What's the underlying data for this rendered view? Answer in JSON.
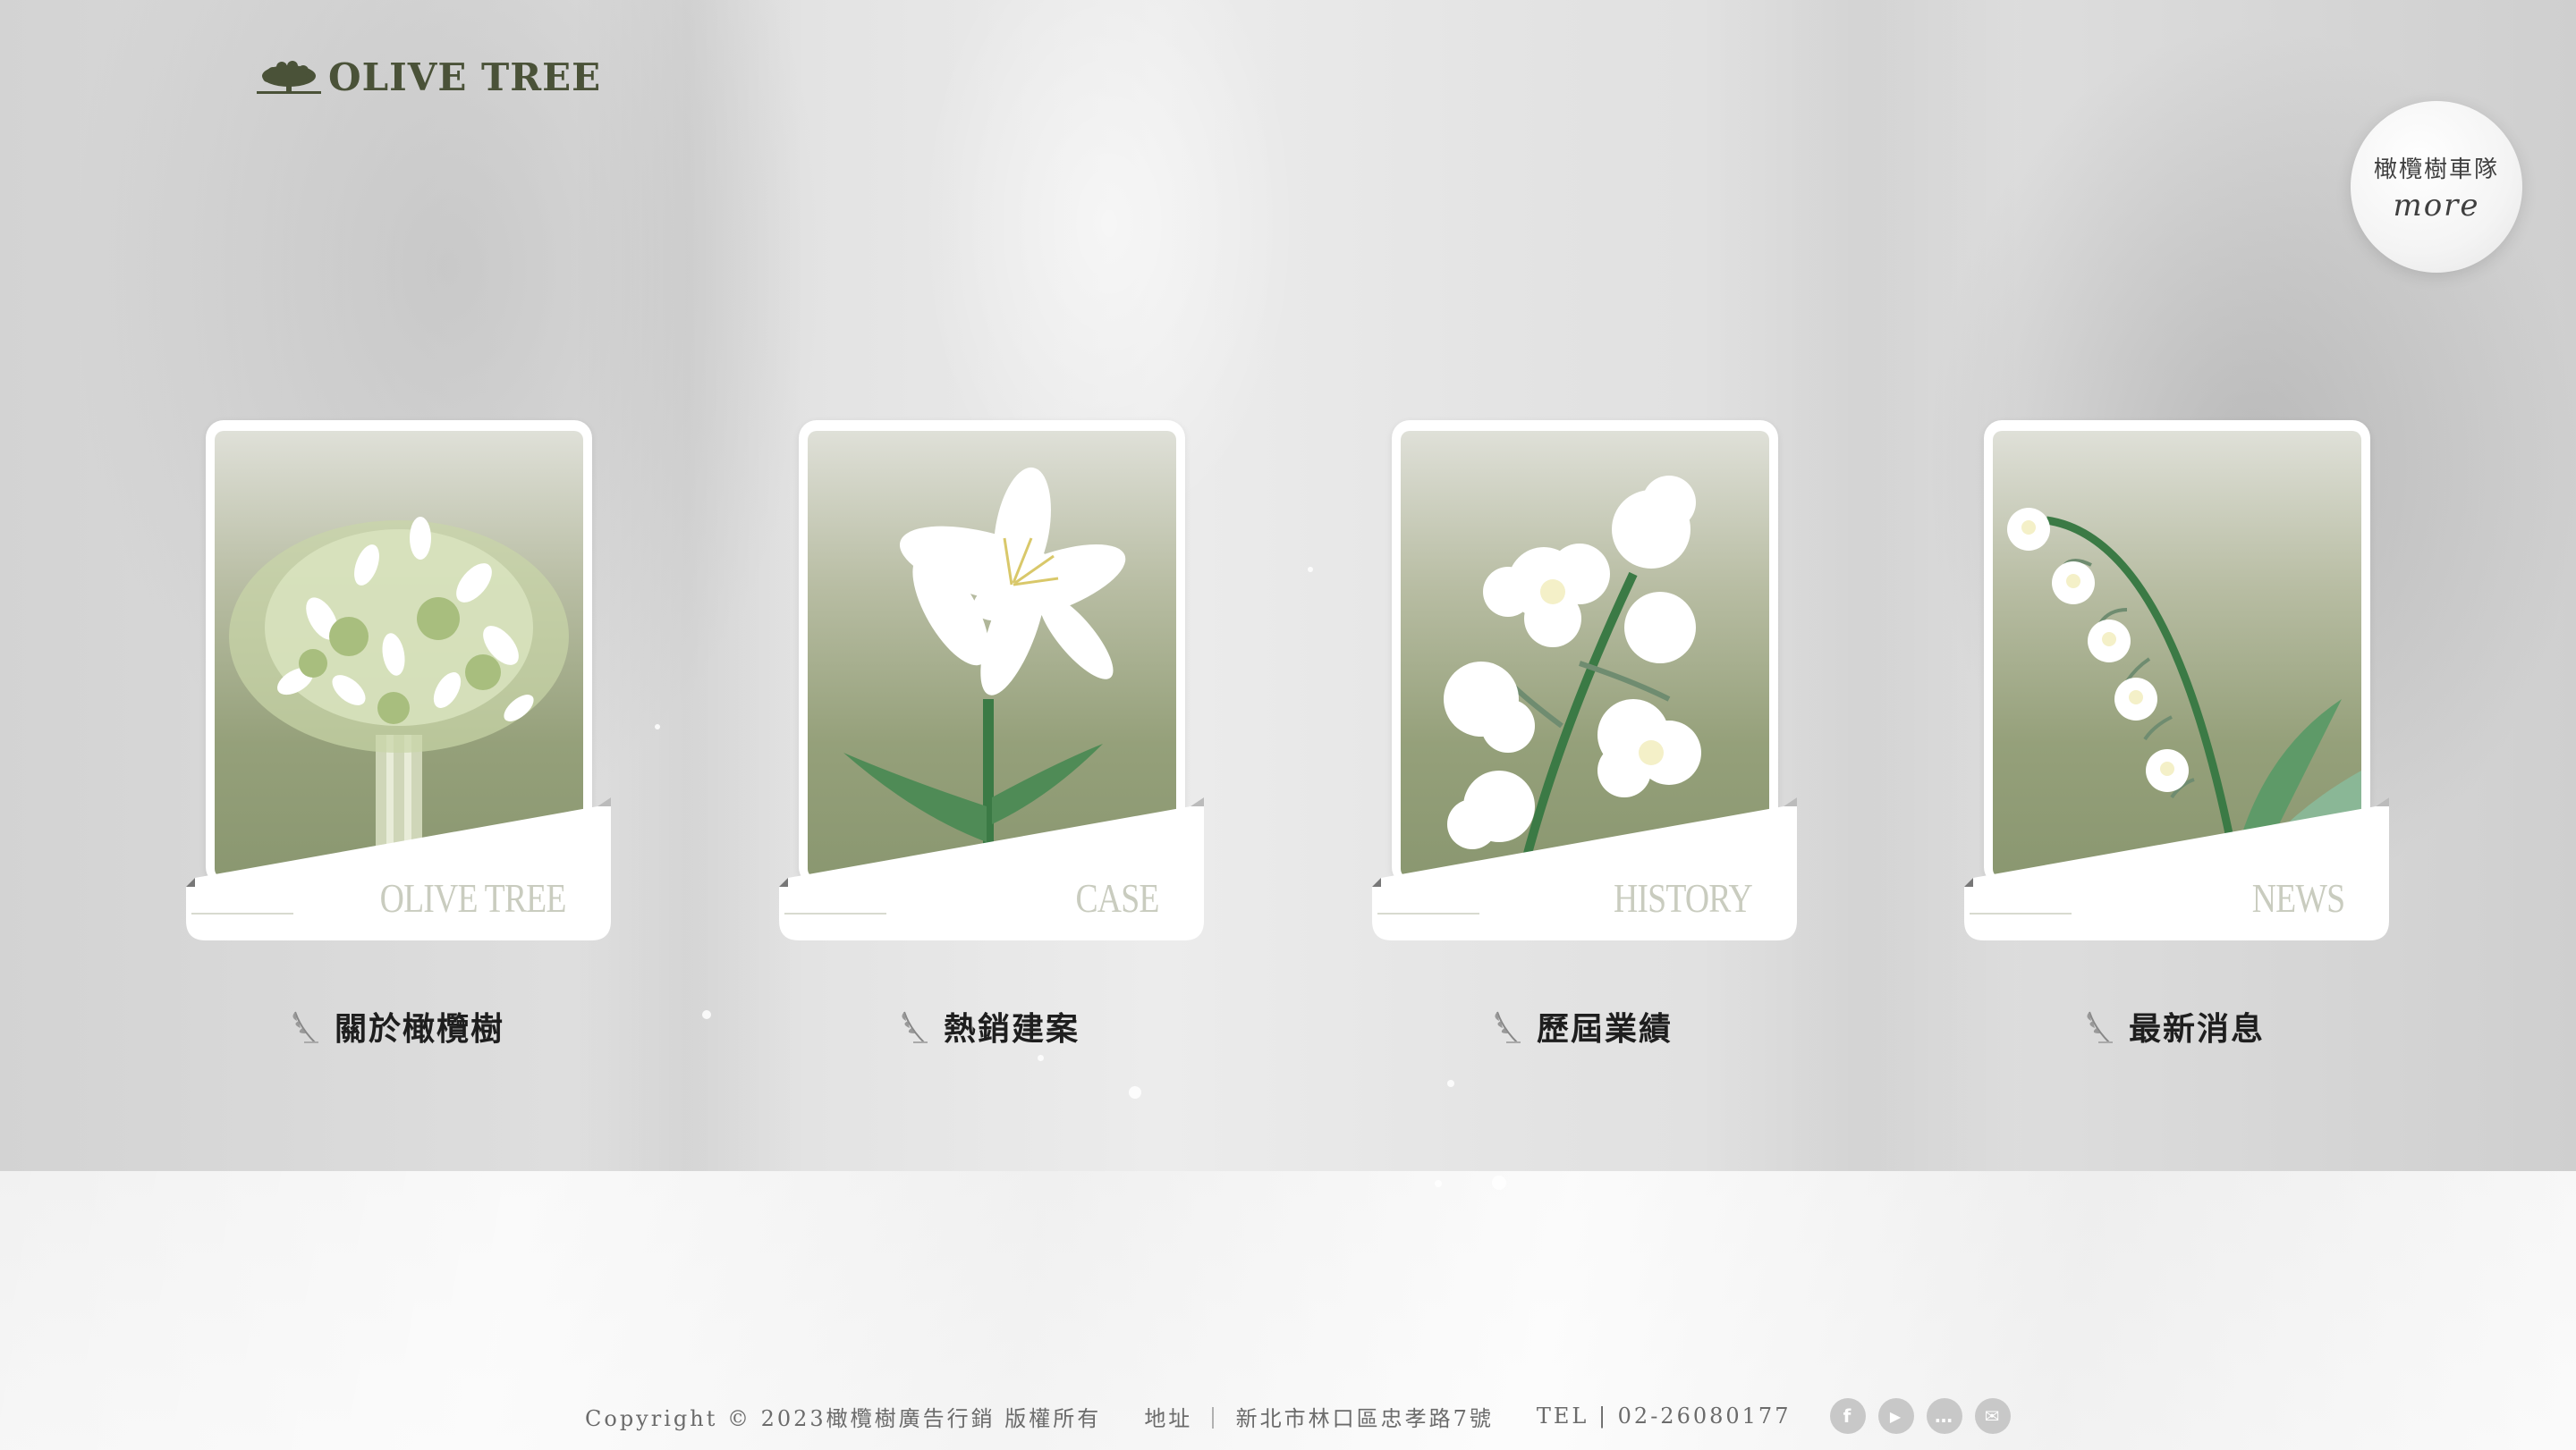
{
  "brand": {
    "logo_text": "OLIVE TREE"
  },
  "team_button": {
    "line1": "橄欖樹車隊",
    "line2": "more"
  },
  "cards": [
    {
      "word": "OLIVE TREE",
      "label": "關於橄欖樹"
    },
    {
      "word": "CASE",
      "label": "熱銷建案"
    },
    {
      "word": "HISTORY",
      "label": "歷屆業績"
    },
    {
      "word": "NEWS",
      "label": "最新消息"
    }
  ],
  "footer": {
    "copyright": "Copyright © 2023橄欖樹廣告行銷 版權所有",
    "address": "地址 ｜ 新北市林口區忠孝路7號",
    "tel": "TEL | 02-26080177"
  },
  "socials": [
    {
      "icon": "facebook-icon",
      "glyph": "f"
    },
    {
      "icon": "youtube-icon",
      "glyph": "▶"
    },
    {
      "icon": "line-icon",
      "glyph": "…"
    },
    {
      "icon": "mail-icon",
      "glyph": "✉"
    }
  ],
  "colors": {
    "brand_green": "#4a5238",
    "card_green": "#8a9770",
    "text_dark": "#1e1e1e",
    "footer_gray": "#6b6b6b"
  }
}
